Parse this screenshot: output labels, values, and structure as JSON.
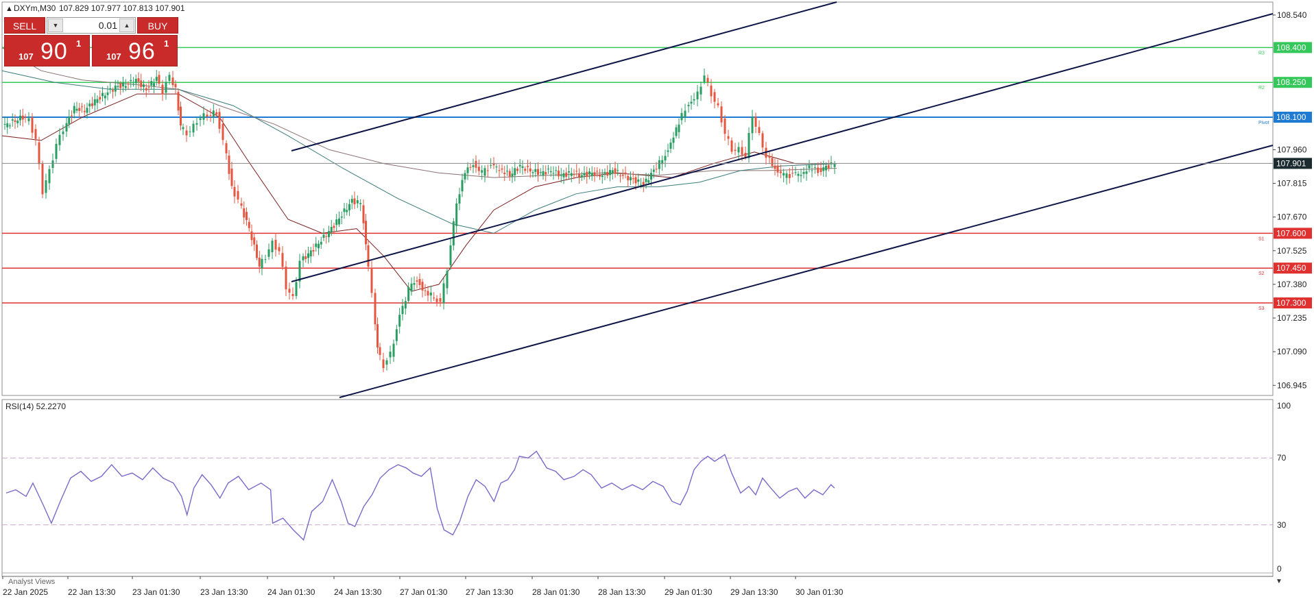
{
  "symbol_header": {
    "symbol": "DXYm,M30",
    "ohlc": "107.829 107.977 107.813 107.901",
    "collapse_icon": "triangle-up-icon"
  },
  "trade_panel": {
    "sell_label": "SELL",
    "buy_label": "BUY",
    "lot_value": "0.01",
    "sell_price_prefix": "107",
    "sell_price_big": "90",
    "sell_price_sup": "1",
    "buy_price_prefix": "107",
    "buy_price_big": "96",
    "buy_price_sup": "1"
  },
  "price_axis": {
    "ticks": [
      "108.540",
      "108.400",
      "108.250",
      "108.100",
      "107.960",
      "107.901",
      "107.815",
      "107.670",
      "107.600",
      "107.525",
      "107.450",
      "107.380",
      "107.300",
      "107.235",
      "107.090",
      "106.945"
    ]
  },
  "levels": [
    {
      "name": "R3",
      "price": 108.4,
      "color": "#34c759",
      "label": "R3"
    },
    {
      "name": "R2",
      "price": 108.25,
      "color": "#34c759",
      "label": "R2"
    },
    {
      "name": "Pivot",
      "price": 108.1,
      "color": "#1f7bd1",
      "label": "Pivot"
    },
    {
      "name": "S1",
      "price": 107.6,
      "color": "#e03131",
      "label": "S1"
    },
    {
      "name": "S2",
      "price": 107.45,
      "color": "#e03131",
      "label": "S2"
    },
    {
      "name": "S3",
      "price": 107.3,
      "color": "#e03131",
      "label": "S3"
    }
  ],
  "current_price": {
    "value": "107.901",
    "price": 107.901
  },
  "rsi": {
    "label": "RSI(14) 52.2270",
    "levels": [
      "100",
      "70",
      "30",
      "0"
    ]
  },
  "time_axis": {
    "labels": [
      "22 Jan 2025",
      "22 Jan 13:30",
      "23 Jan 01:30",
      "23 Jan 13:30",
      "24 Jan 01:30",
      "24 Jan 13:30",
      "27 Jan 01:30",
      "27 Jan 13:30",
      "28 Jan 01:30",
      "28 Jan 13:30",
      "29 Jan 01:30",
      "29 Jan 13:30",
      "30 Jan 01:30"
    ]
  },
  "footer": {
    "tab_label": "Analyst Views"
  },
  "colors": {
    "bull": "#2a9d62",
    "bear": "#e4563f",
    "channel": "#0d1446",
    "ma1": "#7a1b1b",
    "ma2": "#8a7070",
    "ma3": "#3a7a7a",
    "rsi": "#7b68c9"
  }
}
